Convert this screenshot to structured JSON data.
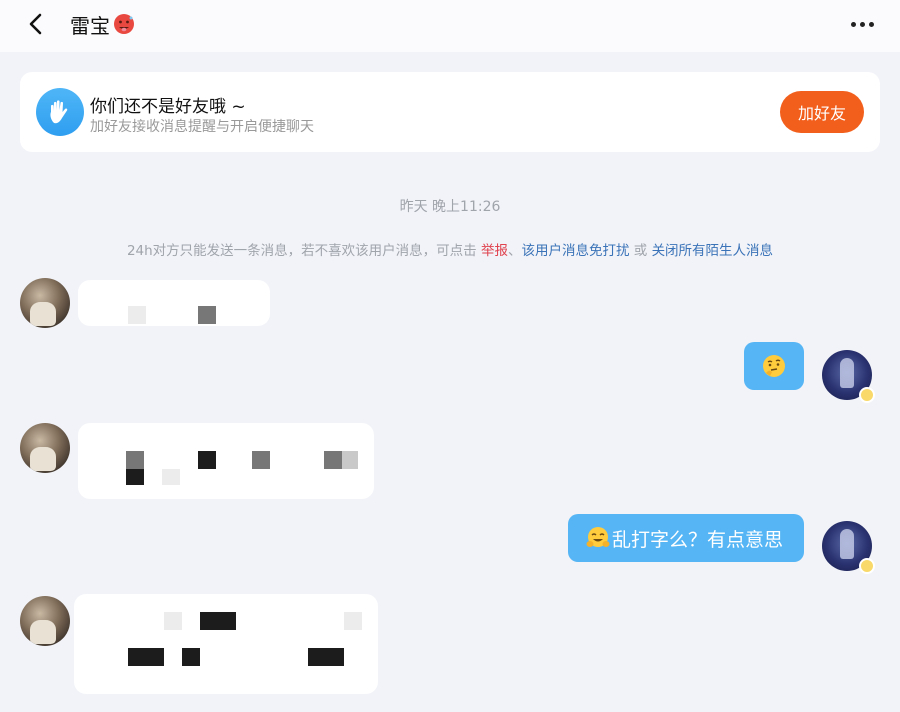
{
  "header": {
    "back_label": "back",
    "title": "雷宝",
    "title_emoji": "hot-face-emoji"
  },
  "friend_card": {
    "title": "你们还不是好友哦 ~",
    "subtitle": "加好友接收消息提醒与开启便捷聊天",
    "button": "加好友",
    "accent": "#f25f1c"
  },
  "chat": {
    "timestamp": "昨天 晚上11:26",
    "notice": {
      "prefix": "24h对方只能发送一条消息，若不喜欢该用户消息，可点击",
      "report": "举报",
      "sep1": "、",
      "mute": "该用户消息免打扰",
      "or": "或",
      "close_all": "关闭所有陌生人消息"
    },
    "messages": [
      {
        "side": "left",
        "content": "pixelated"
      },
      {
        "side": "right",
        "content_emoji": "thinking-face-emoji",
        "text": ""
      },
      {
        "side": "left",
        "content": "pixelated"
      },
      {
        "side": "right",
        "content_emoji": "hugging-face-emoji",
        "text": "乱打字么？有点意思"
      },
      {
        "side": "left",
        "content": "pixelated"
      }
    ]
  },
  "colors": {
    "bubble_right": "#56b5f4",
    "background": "#f1f3f8",
    "link_red": "#e0424e",
    "link_blue": "#3b73b8"
  }
}
